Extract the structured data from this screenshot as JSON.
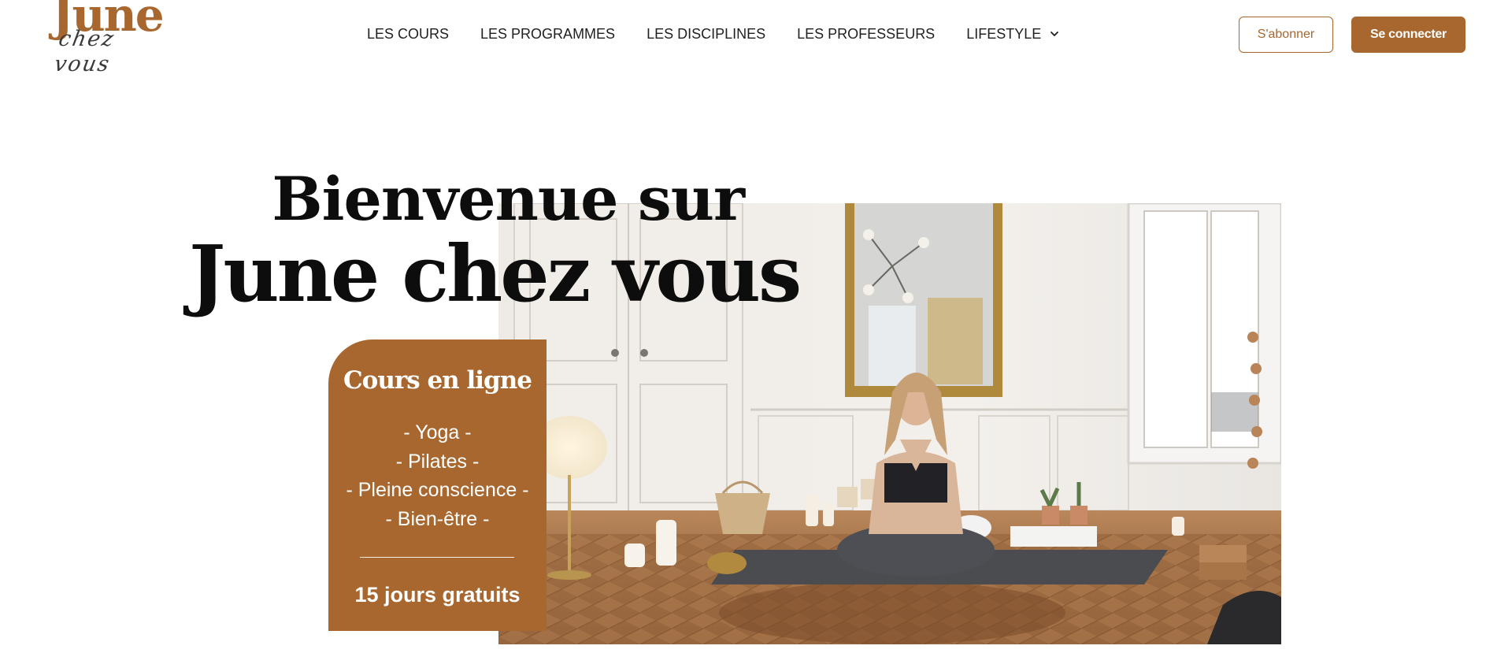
{
  "brand": {
    "logo_main": "June",
    "logo_sub": "chez vous",
    "accent_color": "#a8672f"
  },
  "nav": {
    "items": [
      {
        "label": "LES COURS"
      },
      {
        "label": "LES PROGRAMMES"
      },
      {
        "label": "LES DISCIPLINES"
      },
      {
        "label": "LES PROFESSEURS"
      },
      {
        "label": "LIFESTYLE",
        "icon": "chevron-down-icon"
      }
    ]
  },
  "actions": {
    "subscribe_label": "S'abonner",
    "login_label": "Se connecter"
  },
  "hero": {
    "title_line1": "Bienvenue sur",
    "title_line2": "June chez vous",
    "image": "yoga-studio-photo"
  },
  "card": {
    "title": "Cours en ligne",
    "items": [
      "- Yoga -",
      "- Pilates -",
      "- Pleine conscience -",
      "- Bien-être -"
    ],
    "footer": "15 jours gratuits"
  }
}
